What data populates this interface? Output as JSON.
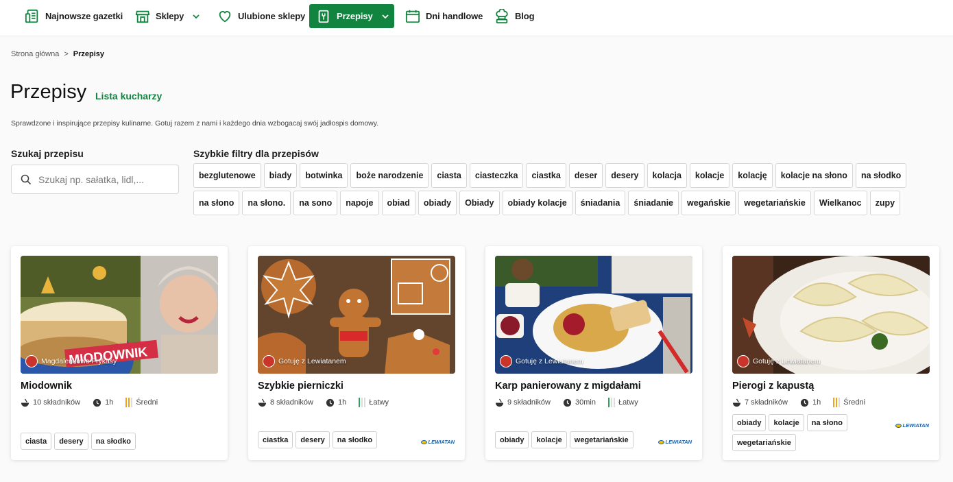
{
  "nav": {
    "items": [
      {
        "label": "Najnowsze gazetki",
        "icon": "leaflet-icon"
      },
      {
        "label": "Sklepy",
        "icon": "store-icon"
      },
      {
        "label": "Ulubione sklepy",
        "icon": "heart-icon"
      },
      {
        "label": "Przepisy",
        "icon": "recipe-icon"
      },
      {
        "label": "Dni handlowe",
        "icon": "calendar-icon"
      },
      {
        "label": "Blog",
        "icon": "chef-icon"
      }
    ],
    "active_color": "#11843f"
  },
  "breadcrumb": {
    "home": "Strona główna",
    "separator": ">",
    "current": "Przepisy"
  },
  "page": {
    "title": "Przepisy",
    "cooks_link": "Lista kucharzy",
    "intro": "Sprawdzone i inspirujące przepisy kulinarne. Gotuj razem z nami i każdego dnia wzbogacaj swój jadłospis domowy."
  },
  "search": {
    "label": "Szukaj przepisu",
    "placeholder": "Szukaj np. sałatka, lidl,...",
    "value": ""
  },
  "filters": {
    "label": "Szybkie filtry dla przepisów",
    "chips": [
      "bezglutenowe",
      "biady",
      "botwinka",
      "boże narodzenie",
      "ciasta",
      "ciasteczka",
      "ciastka",
      "deser",
      "desery",
      "kolacja",
      "kolacje",
      "kolację",
      "kolacje na słono",
      "na słodko",
      "na słono",
      "na słono.",
      "na sono",
      "napoje",
      "obiad",
      "obiady",
      "Obiady",
      "obiady kolacje",
      "śniadania",
      "śniadanie",
      "wegańskie",
      "wegetariańskie",
      "Wielkanoc",
      "zupy"
    ]
  },
  "recipes": [
    {
      "title": "Miodownik",
      "author": "Magdalenkowe Frykasy",
      "ingredients": "10 składników",
      "time": "1h",
      "difficulty": "Średni",
      "tags": [
        "ciasta",
        "desery",
        "na słodko"
      ],
      "overlay_text": "MIODOWNIK"
    },
    {
      "title": "Szybkie pierniczki",
      "author": "Gotuję z Lewiatanem",
      "ingredients": "8 składników",
      "time": "1h",
      "difficulty": "Łatwy",
      "tags": [
        "ciastka",
        "desery",
        "na słodko"
      ],
      "brand": "LEWIATAN"
    },
    {
      "title": "Karp panierowany z migdałami",
      "author": "Gotuję z Lewiatanem",
      "ingredients": "9 składników",
      "time": "30min",
      "difficulty": "Łatwy",
      "tags": [
        "obiady",
        "kolacje",
        "wegetariańskie"
      ],
      "brand": "LEWIATAN"
    },
    {
      "title": "Pierogi z kapustą",
      "author": "Gotuję z Lewiatanem",
      "ingredients": "7 składników",
      "time": "1h",
      "difficulty": "Średni",
      "tags": [
        "obiady",
        "kolacje",
        "na słono",
        "wegetariańskie"
      ],
      "brand": "LEWIATAN"
    }
  ],
  "colors": {
    "easy": "#2aa55a",
    "medium": "#f0a21a",
    "brand_blue": "#1a5fa8"
  }
}
